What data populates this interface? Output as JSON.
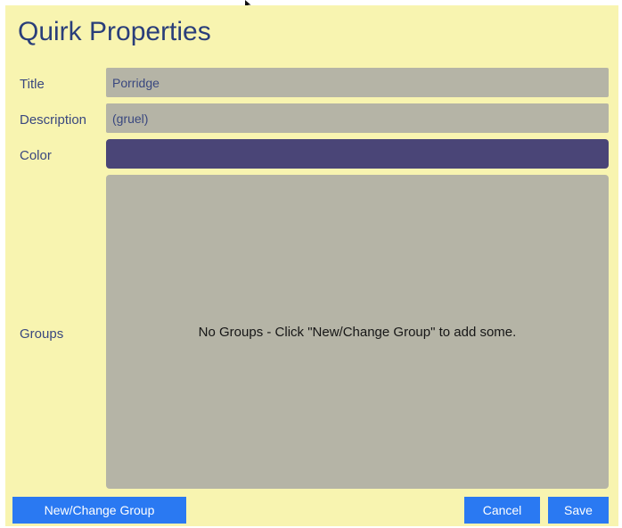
{
  "dialog": {
    "title": "Quirk Properties"
  },
  "form": {
    "title_label": "Title",
    "title_value": "Porridge",
    "description_label": "Description",
    "description_value": "(gruel)",
    "color_label": "Color",
    "color_value": "#4a4577",
    "groups_label": "Groups",
    "groups_empty_message": "No Groups - Click \"New/Change Group\" to add some."
  },
  "buttons": {
    "new_change_group": "New/Change Group",
    "cancel": "Cancel",
    "save": "Save"
  },
  "colors": {
    "background": "#f8f4b0",
    "field": "#b5b4a6",
    "text": "#39477f",
    "button": "#2a79f2"
  },
  "icons": {
    "cursor": "mouse-pointer-icon"
  }
}
